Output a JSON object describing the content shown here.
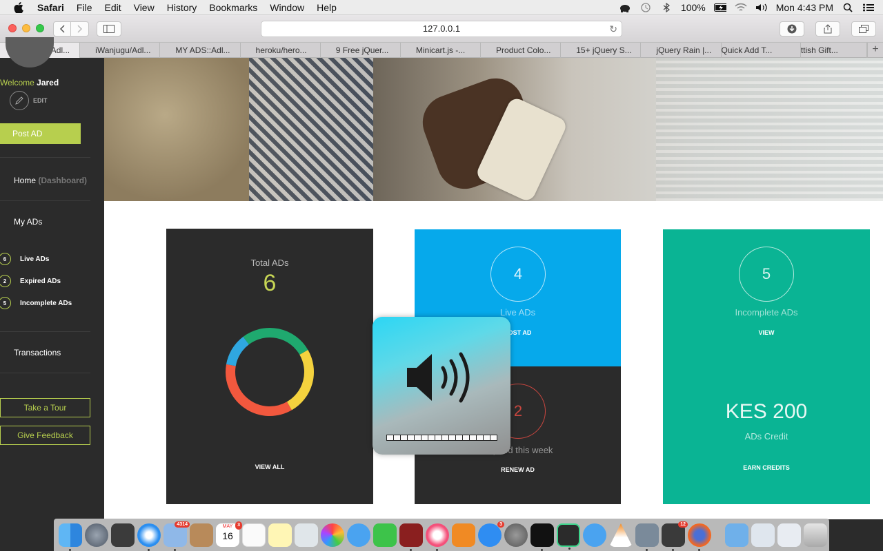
{
  "menubar": {
    "app_name": "Safari",
    "items": [
      "File",
      "Edit",
      "View",
      "History",
      "Bookmarks",
      "Window",
      "Help"
    ],
    "battery": "100%",
    "clock": "Mon 4:43 PM"
  },
  "browser": {
    "url": "127.0.0.1",
    "tabs": [
      "MY ADS::Adl...",
      "iWanjugu/Adl...",
      "MY ADS::Adl...",
      "heroku/hero...",
      "9 Free jQuer...",
      "Minicart.js -...",
      "Product Colo...",
      "15+ jQuery S...",
      "jQuery Rain |...",
      "Quick Add T...",
      "ttish Gift..."
    ],
    "active_tab": 0
  },
  "sidebar": {
    "welcome_prefix": "Welcome",
    "user_name": "Jared",
    "edit_label": "EDIT",
    "post_ad": "Post AD",
    "home": "Home",
    "home_sub": "(Dashboard)",
    "my_ads": "My ADs",
    "ad_counts": [
      {
        "count": "6",
        "label": "Live ADs"
      },
      {
        "count": "2",
        "label": "Expired ADs"
      },
      {
        "count": "5",
        "label": "Incomplete ADs"
      }
    ],
    "transactions": "Transactions",
    "take_tour": "Take a Tour",
    "give_feedback": "Give Feedback"
  },
  "cards": {
    "total": {
      "label": "Total ADs",
      "value": "6",
      "link": "VIEW ALL"
    },
    "live": {
      "value": "4",
      "label": "Live ADs",
      "link": "POST AD"
    },
    "expired": {
      "value": "2",
      "label": "Expired this week",
      "link": "RENEW AD"
    },
    "incomplete": {
      "value": "5",
      "label": "Incomplete ADs",
      "link": "VIEW"
    },
    "credit": {
      "value": "KES 200",
      "label": "ADs Credit",
      "link": "EARN CREDITS"
    }
  },
  "donut_colors": [
    "#f2583e",
    "#2fa7e0",
    "#1fa96f",
    "#f4d23e"
  ],
  "colors": {
    "accent": "#b7cf4e",
    "live": "#06a9eb",
    "incomplete": "#0ab494",
    "dark": "#2b2b2b"
  },
  "volume_hud": {
    "icon": "speaker-volume-icon",
    "level": 1.0
  },
  "dock": {
    "badges": {
      "mail": "4314",
      "calendar": "3",
      "app_store": "3",
      "sublime": "12"
    },
    "calendar_month": "MAY",
    "calendar_day": "16"
  }
}
